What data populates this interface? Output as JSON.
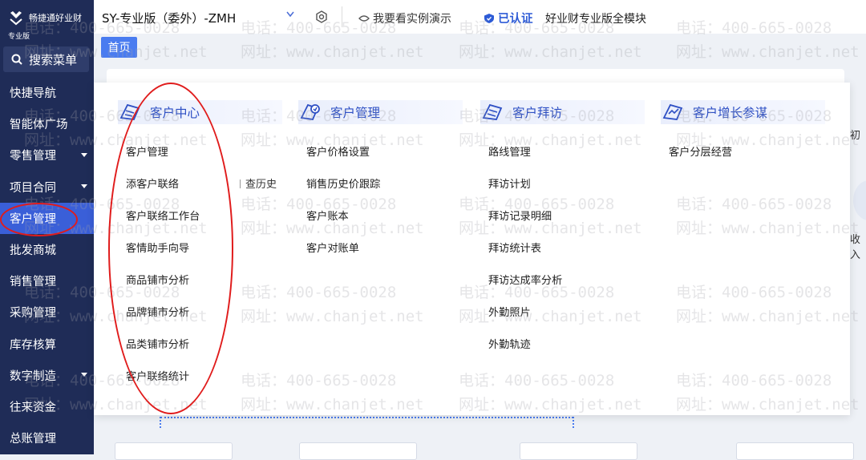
{
  "sidebar": {
    "brand_name": "畅捷通好业财",
    "brand_edition": "专业版",
    "search_label": "搜索菜单",
    "items": [
      {
        "label": "快捷导航",
        "has_caret": false
      },
      {
        "label": "智能体广场",
        "has_caret": false
      },
      {
        "label": "零售管理",
        "has_caret": true
      },
      {
        "label": "项目合同",
        "has_caret": true
      },
      {
        "label": "客户管理",
        "has_caret": false,
        "active": true
      },
      {
        "label": "批发商城",
        "has_caret": false
      },
      {
        "label": "销售管理",
        "has_caret": false
      },
      {
        "label": "采购管理",
        "has_caret": false
      },
      {
        "label": "库存核算",
        "has_caret": false
      },
      {
        "label": "数字制造",
        "has_caret": true
      },
      {
        "label": "往来资金",
        "has_caret": false
      },
      {
        "label": "总账管理",
        "has_caret": false
      }
    ]
  },
  "topbar": {
    "account_title": "SY-专业版（委外）-ZMH",
    "demo_label": "我要看实例演示",
    "certified_label": "已认证",
    "module_label": "好业财专业版全模块"
  },
  "tabs": {
    "home": "首页"
  },
  "background": {
    "right_text_1": "初",
    "right_text_2": "收入"
  },
  "panel": {
    "columns": [
      {
        "title": "客户中心",
        "icon": "customer-center-icon",
        "items": [
          "客户管理",
          "添客户联络",
          "客户联络工作台",
          "客情助手向导",
          "商品铺市分析",
          "品牌铺市分析",
          "品类铺市分析",
          "客户联络统计"
        ]
      },
      {
        "title": "客户管理",
        "icon": "customer-management-icon",
        "items": [
          "客户价格设置",
          "销售历史价跟踪",
          "客户账本",
          "客户对账单"
        ]
      },
      {
        "title": "客户拜访",
        "icon": "customer-visit-icon",
        "items": [
          "路线管理",
          "拜访计划",
          "拜访记录明细",
          "拜访统计表",
          "拜访达成率分析",
          "外勤照片",
          "外勤轨迹"
        ]
      },
      {
        "title": "客户增长参谋",
        "icon": "customer-growth-icon",
        "items": [
          "客户分层经营"
        ]
      }
    ],
    "extra_label": "查历史"
  },
  "watermark": {
    "phone": "电话：400-665-0028",
    "site": "网址：www.chanjet.net"
  },
  "colors": {
    "sidebar_bg": "#1f2c57",
    "accent": "#3a5fd8",
    "annotation": "#e01c1c"
  }
}
